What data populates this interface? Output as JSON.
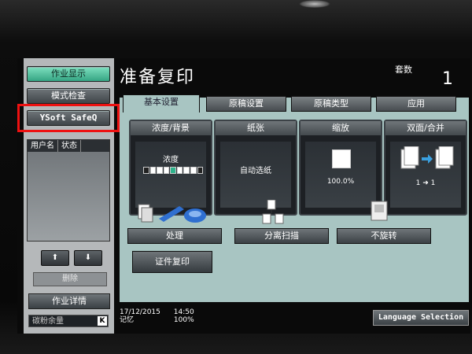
{
  "left_panel": {
    "job_display": "作业显示",
    "mode_check": "模式检查",
    "ysoft": "YSoft SafeQ",
    "list_headers": [
      "用户名",
      "状态"
    ],
    "up_arrow": "⬆",
    "down_arrow": "⬇",
    "delete": "删除",
    "job_details": "作业详情",
    "toner": "碳粉余量",
    "toner_color": "K"
  },
  "header": {
    "title": "准备复印",
    "sets_label": "套数",
    "sets_value": "1"
  },
  "tabs": [
    "基本设置",
    "原稿设置",
    "原稿类型",
    "应用"
  ],
  "tiles": {
    "density": {
      "header": "浓度/背景",
      "label": "浓度"
    },
    "paper": {
      "header": "纸张",
      "value": "自动选纸"
    },
    "zoom": {
      "header": "缩放",
      "value": "100.0%"
    },
    "duplex": {
      "header": "双面/合并",
      "value": "1 ➜ 1"
    }
  },
  "functions": {
    "finishing": "处理",
    "separate_scan": "分离扫描",
    "no_rotate": "不旋转",
    "id_copy": "证件复印"
  },
  "status": {
    "date": "17/12/2015",
    "time": "14:50",
    "memory_label": "记忆",
    "memory_value": "100%",
    "language": "Language Selection"
  },
  "colors": {
    "highlight_box": "#e11111",
    "active_button": "#35a583",
    "main_bg": "#a8c5c2"
  }
}
